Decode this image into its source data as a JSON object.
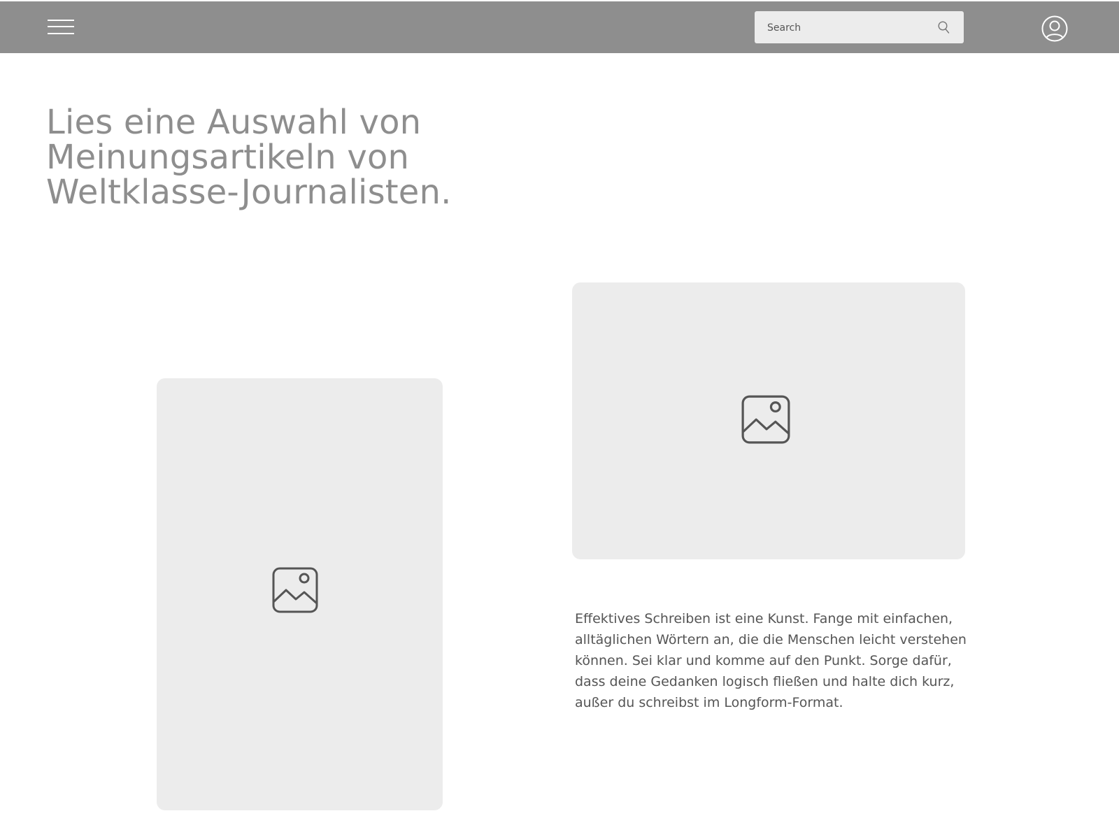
{
  "header": {
    "menu_icon": "hamburger-menu-icon",
    "search": {
      "placeholder": "Search",
      "icon": "search-icon"
    },
    "profile_icon": "user-profile-icon"
  },
  "main": {
    "headline": "Lies eine Auswahl von Meinungsartikeln von Weltklasse-Journalisten.",
    "images": [
      {
        "icon": "image-placeholder-icon"
      },
      {
        "icon": "image-placeholder-icon"
      }
    ],
    "body_text": "Effektives Schreiben ist eine Kunst. Fange mit einfachen, alltäglichen Wörtern an, die die Menschen leicht verstehen können. Sei klar und komme auf den Punkt. Sorge dafür, dass deine Gedanken logisch fließen und halte dich kurz, außer du schreibst im Longform-Format."
  },
  "colors": {
    "header_bg": "#8e8e8e",
    "headline": "#8e8e8e",
    "placeholder_bg": "#ececec",
    "text": "#555555",
    "search_bg": "#ececec"
  }
}
